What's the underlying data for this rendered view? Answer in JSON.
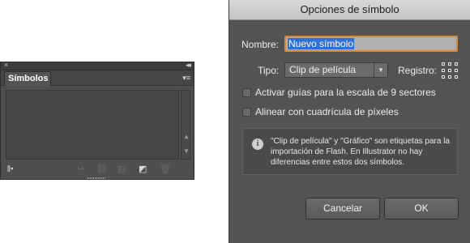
{
  "panel": {
    "close_glyph": "×",
    "collapse_glyph": "◂◂",
    "tab_label": "Símbolos",
    "menu_glyph": "▾≡",
    "scroll_up": "▲",
    "scroll_down": "▼",
    "toolbar": {
      "library_glyph": "𝍪▾",
      "place_glyph": "↪",
      "break_link_glyph": "⛓",
      "options_glyph": "▤",
      "new_symbol_glyph": "◩",
      "delete_glyph": "🗑"
    },
    "resize_glyph": "⋰"
  },
  "dialog": {
    "title": "Opciones de símbolo",
    "name_label": "Nombre:",
    "name_value": "Nuevo símbolo",
    "type_label": "Tipo:",
    "type_value": "Clip de película",
    "type_arrow": "▼",
    "registration_label": "Registro:",
    "nine_slice_label": "Activar guías para la escala de 9 sectores",
    "nine_slice_checked": false,
    "pixel_grid_label": "Alinear con cuadrícula de píxeles",
    "pixel_grid_checked": false,
    "info_icon": "i",
    "info_text": "\"Clip de película\" y \"Gráfico\" son etiquetas para la importación de Flash. En Illustrator no hay diferencias entre estos dos símbolos.",
    "cancel_label": "Cancelar",
    "ok_label": "OK"
  }
}
